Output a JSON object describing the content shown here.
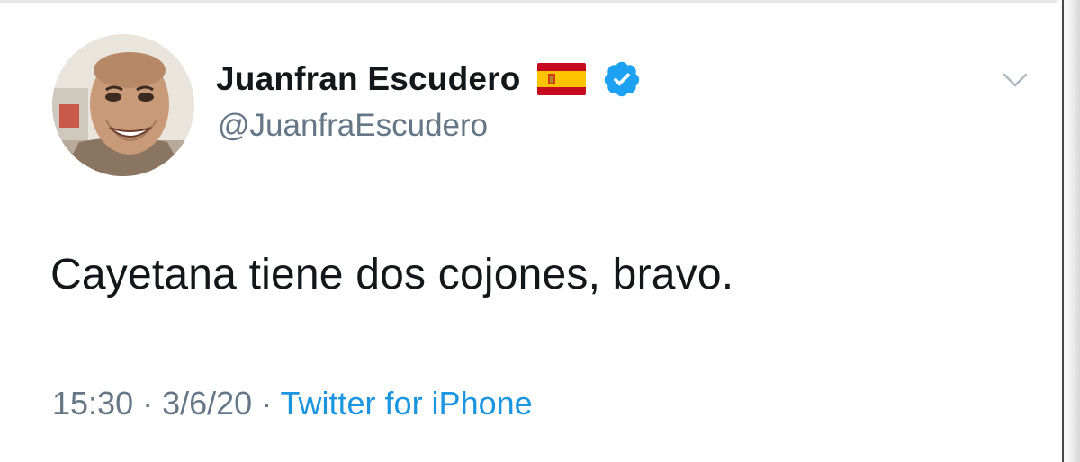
{
  "tweet": {
    "display_name": "Juanfran Escudero",
    "flag_icon": "spain-flag-icon",
    "verified_icon": "verified-badge-icon",
    "handle": "@JuanfraEscudero",
    "text": "Cayetana tiene dos cojones, bravo.",
    "time": "15:30",
    "separator": " · ",
    "date": "3/6/20",
    "source": "Twitter for iPhone"
  },
  "colors": {
    "text": "#14171a",
    "secondary": "#657786",
    "link": "#1b95e0",
    "verified": "#1da1f2"
  }
}
